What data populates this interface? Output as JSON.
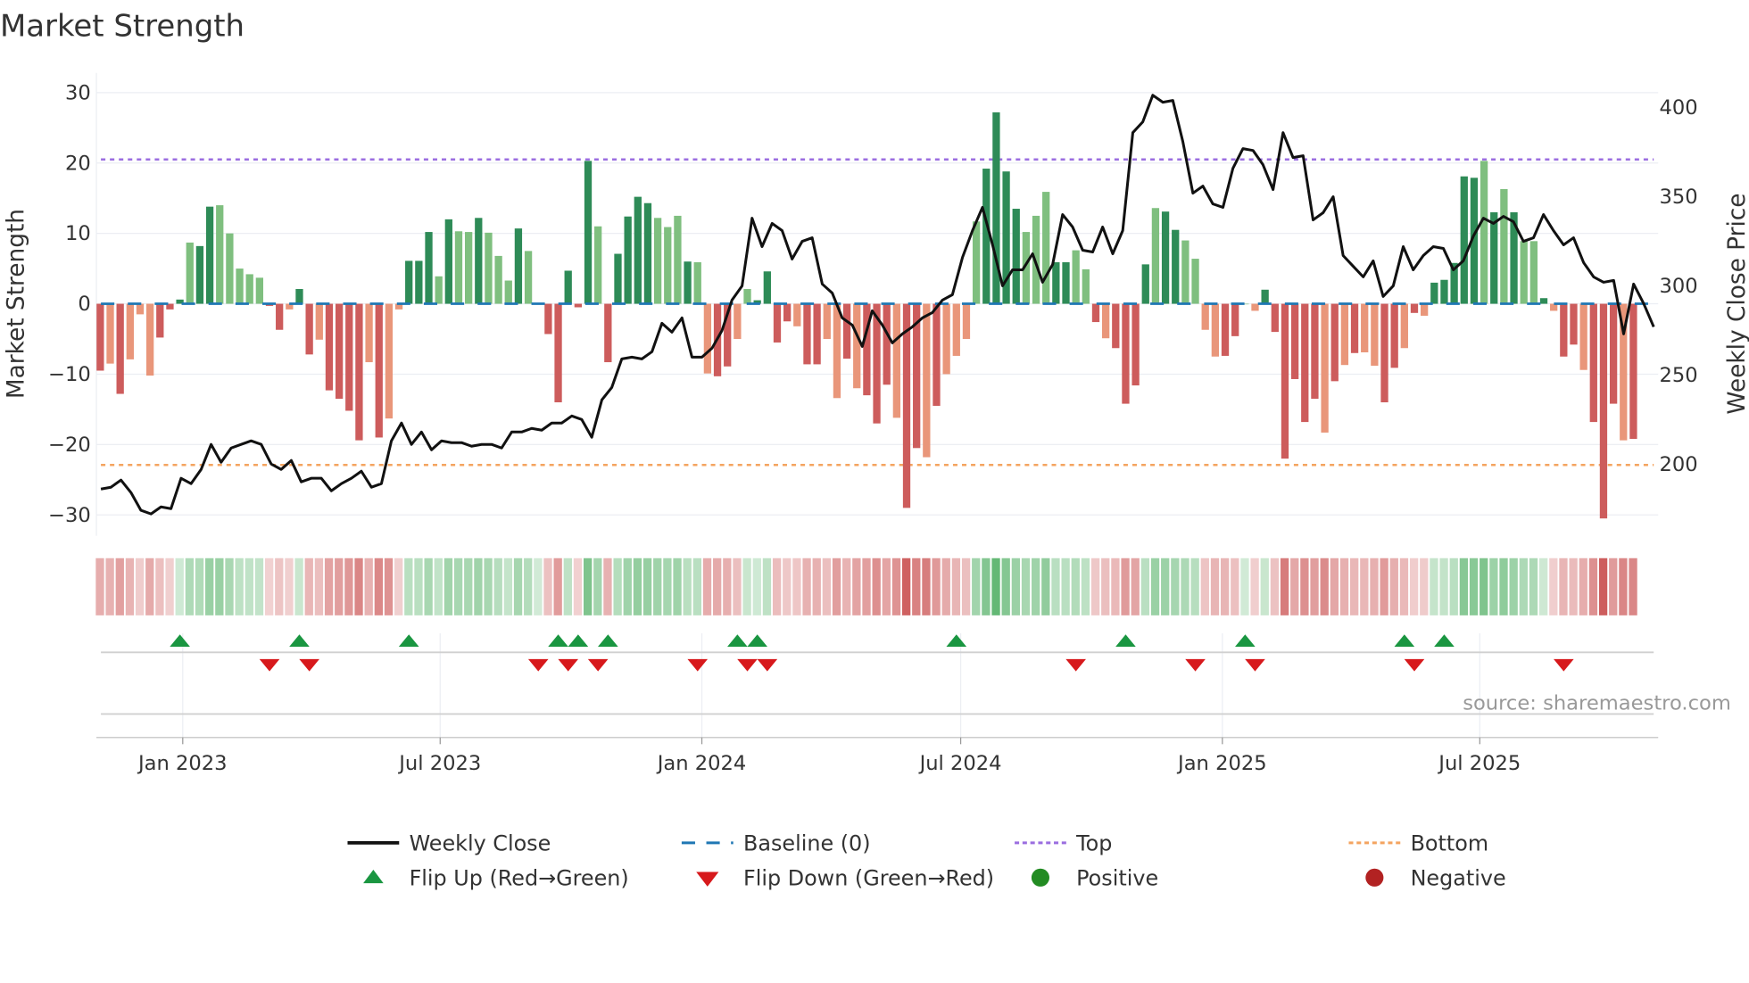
{
  "chart_data": {
    "type": "bar",
    "title": "Market Strength",
    "ylabel": "Market Strength",
    "y2label": "Weekly Close Price",
    "ylim": [
      -33,
      33
    ],
    "y2lim": [
      168,
      422
    ],
    "yticks": [
      30,
      20,
      10,
      0,
      -10,
      -20,
      -30
    ],
    "yticklabels": [
      "30",
      "20",
      "10",
      "0",
      "−10",
      "−20",
      "−30"
    ],
    "y2ticks": [
      400,
      350,
      300,
      250,
      200
    ],
    "y2ticklabels": [
      "400",
      "350",
      "300",
      "250",
      "200"
    ],
    "xticks": [
      "2023-01-01",
      "2023-07-01",
      "2024-01-01",
      "2024-07-01",
      "2025-01-01",
      "2025-07-01"
    ],
    "xticklabels": [
      "Jan 2023",
      "Jul 2023",
      "Jan 2024",
      "Jul 2024",
      "Jan 2025",
      "Jul 2025"
    ],
    "start_date": "2022-11-04",
    "interval_days": 7,
    "top_level": 20.5,
    "bottom_level": -22.9,
    "baseline": 0,
    "grid": true,
    "strength": [
      -9.5,
      -8.5,
      -12.8,
      -7.9,
      -1.5,
      -10.2,
      -4.8,
      -0.8,
      0.6,
      8.7,
      8.2,
      13.8,
      14,
      10,
      5,
      4.2,
      3.7,
      -0.3,
      -3.7,
      -0.8,
      2.1,
      -7.2,
      -5.1,
      -12.3,
      -13.5,
      -15.2,
      -19.4,
      -8.3,
      -19,
      -16.3,
      -0.8,
      6.1,
      6.1,
      10.2,
      3.9,
      12,
      10.3,
      10.2,
      12.2,
      10.1,
      6.8,
      3.3,
      10.7,
      7.5,
      0,
      -4.3,
      -14,
      4.7,
      -0.5,
      20.3,
      11,
      -8.3,
      7.1,
      12.4,
      15.2,
      14.3,
      12.2,
      10.9,
      12.5,
      6,
      5.9,
      -9.9,
      -10.3,
      -8.9,
      -5,
      2.1,
      0.5,
      4.6,
      -5.5,
      -2.5,
      -3.2,
      -8.6,
      -8.6,
      -5,
      -13.4,
      -7.8,
      -12,
      -13,
      -17,
      -11.5,
      -16.2,
      -29,
      -20.5,
      -21.8,
      -14.5,
      -10,
      -7.4,
      -5,
      11.7,
      19.2,
      27.2,
      18.8,
      13.5,
      10.2,
      12.5,
      15.9,
      5.9,
      5.9,
      7.6,
      4.9,
      -2.6,
      -4.9,
      -6.3,
      -14.2,
      -11.6,
      5.6,
      13.6,
      13.1,
      10.5,
      9,
      6.4,
      -3.7,
      -7.5,
      -7.4,
      -4.6,
      0,
      -1,
      2,
      -4,
      -22,
      -10.7,
      -16.8,
      -13.5,
      -18.3,
      -11,
      -8.7,
      -7,
      -6.9,
      -8.8,
      -14,
      -9.1,
      -6.3,
      -1.3,
      -1.7,
      3,
      3.4,
      5.8,
      18.1,
      17.9,
      20.3,
      13,
      16.3,
      13,
      8.9,
      8.9,
      0.8,
      -1,
      -7.5,
      -5.8,
      -9.4,
      -16.8,
      -30.5,
      -14.2,
      -19.4,
      -19.2
    ],
    "shade": "dldllldddlddlllllddlddlddddldlldddldlldllldlddddddldddddllldllddllddddlddlldldddlddldllllddddlllddlldlddddlddllllddllddddddldldlldd ldldddddldldlldlddldddldl",
    "weekly_close": [
      186,
      187,
      191,
      184,
      174,
      172,
      176,
      175,
      192,
      189,
      197,
      211,
      201,
      209,
      211,
      213,
      211,
      200,
      197,
      202,
      190,
      192,
      192,
      185,
      189,
      192,
      196,
      187,
      189,
      213,
      223,
      211,
      218,
      208,
      213,
      212,
      212,
      210,
      211,
      211,
      209,
      218,
      218,
      220,
      219,
      223,
      223,
      227,
      225,
      215,
      236,
      243,
      259,
      260,
      259,
      263,
      279,
      274,
      282,
      260,
      260,
      265,
      275,
      292,
      300,
      338,
      322,
      335,
      331,
      315,
      325,
      327,
      301,
      296,
      282,
      278,
      266,
      286,
      278,
      268,
      273,
      277,
      282,
      285,
      292,
      295,
      316,
      331,
      344,
      323,
      300,
      309,
      309,
      318,
      302,
      312,
      340,
      333,
      320,
      319,
      333,
      318,
      331,
      386,
      392,
      407,
      403,
      404,
      381,
      352,
      356,
      346,
      344,
      366,
      377,
      376,
      368,
      354,
      386,
      372,
      373,
      337,
      341,
      350,
      317,
      311,
      305,
      314,
      294,
      300,
      322,
      309,
      317,
      322,
      321,
      309,
      314,
      328,
      338,
      335,
      339,
      336,
      325,
      327,
      340,
      331,
      323,
      327,
      313,
      305,
      302,
      303,
      273,
      301,
      290,
      277
    ],
    "flip_up": [
      "2022-12-30",
      "2023-03-24",
      "2023-06-09",
      "2023-09-22",
      "2023-10-06",
      "2023-10-27",
      "2024-01-26",
      "2024-02-09",
      "2024-06-28",
      "2024-10-25",
      "2025-01-17",
      "2025-05-09",
      "2025-06-06"
    ],
    "flip_down": [
      "2023-03-03",
      "2023-03-31",
      "2023-09-08",
      "2023-09-29",
      "2023-10-20",
      "2023-12-29",
      "2024-02-02",
      "2024-02-16",
      "2024-09-20",
      "2024-12-13",
      "2025-01-24",
      "2025-05-16",
      "2025-08-29"
    ],
    "legend": {
      "placement": "bottom",
      "items": [
        "Weekly Close",
        "Baseline (0)",
        "Top",
        "Bottom",
        "Flip Up (Red→Green)",
        "Flip Down (Green→Red)",
        "Positive",
        "Negative"
      ]
    },
    "colors": {
      "pos_dark": "#2e8b57",
      "pos_light": "#7fbf7f",
      "neg_dark": "#cd5c5c",
      "neg_light": "#e9967a",
      "baseline": "#1f77b4",
      "top": "#9b6ee0",
      "bottom": "#f4a460",
      "flip_up": "#1a9641",
      "flip_down": "#d7191c",
      "positive": "#228b22",
      "negative": "#b22222",
      "close": "#111111"
    }
  },
  "source": "source: sharemaestro.com"
}
